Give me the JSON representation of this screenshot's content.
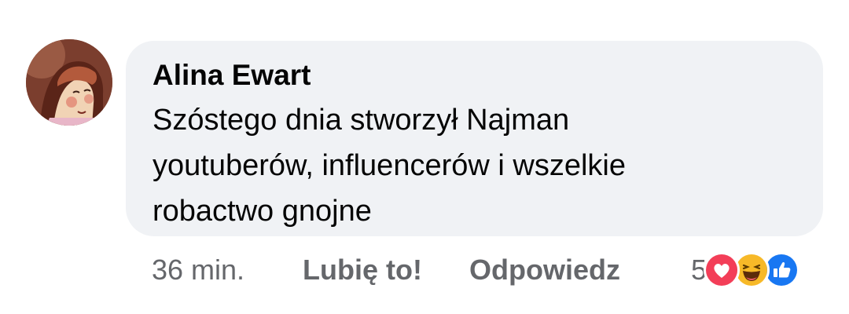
{
  "comment": {
    "author": "Alina Ewart",
    "text": "Szóstego dnia stworzył Najman youtuberów, influencerów i wszelkie robactwo gnojne",
    "time": "36 min.",
    "like_label": "Lubię to!",
    "reply_label": "Odpowiedz",
    "reaction_count": "5",
    "reactions": [
      "love-icon",
      "haha-icon",
      "like-icon"
    ]
  },
  "colors": {
    "bubble": "#f0f2f5",
    "meta_text": "#65676b",
    "love": "#f33e58",
    "haha": "#f7b928",
    "like": "#1877f2"
  }
}
